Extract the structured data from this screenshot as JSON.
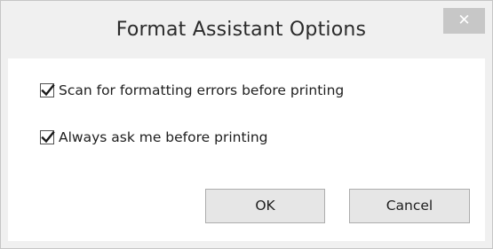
{
  "window": {
    "title": "Format Assistant Options",
    "close_label": "✕"
  },
  "options": [
    {
      "label": "Scan for formatting errors before printing",
      "checked": true
    },
    {
      "label": "Always ask me before printing",
      "checked": true
    }
  ],
  "buttons": {
    "ok_label": "OK",
    "cancel_label": "Cancel"
  }
}
